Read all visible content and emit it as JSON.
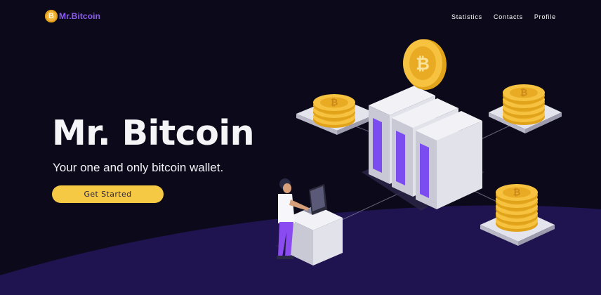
{
  "brand": {
    "logo_text": "Mr.Bitcoin",
    "coin_glyph": "B",
    "accent": "#8c5cf2"
  },
  "nav": {
    "items": [
      "Statistics",
      "Contacts",
      "Profile"
    ]
  },
  "hero": {
    "title": "Mr. Bitcoin",
    "subtitle": "Your one and only bitcoin wallet.",
    "cta_label": "Get Started"
  },
  "colors": {
    "background": "#0c0a1a",
    "hill": "#1f1450",
    "cta": "#f6c945",
    "coin": "#f4b63a",
    "server_stripe": "#7b4cf0"
  },
  "icons": [
    "bitcoin-coin-icon",
    "server-icon",
    "laptop-icon"
  ]
}
